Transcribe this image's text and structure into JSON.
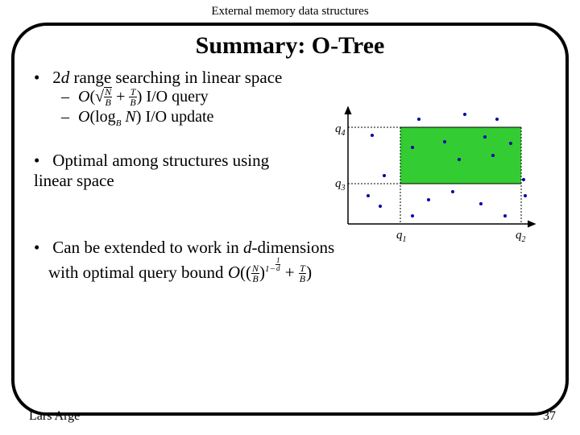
{
  "header": "External memory data structures",
  "title": "Summary: O-Tree",
  "bullets": {
    "b1_prefix": "2",
    "b1_var": "d",
    "b1_rest": " range searching in linear space",
    "s1_suffix": "I/O query",
    "s2_suffix": "I/O update",
    "b2": "Optimal among structures using linear space",
    "b3_line1": "Can be extended to work in ",
    "b3_var": "d",
    "b3_line1b": "-dimensions",
    "b3_line2": "with optimal query bound"
  },
  "math": {
    "O": "O",
    "lparen": "(",
    "rparen": ")",
    "sqrt": "√",
    "plus": " + ",
    "NB_num": "N",
    "NB_den": "B",
    "TB_num": "T",
    "TB_den": "B",
    "log": "log",
    "logsub": "B",
    "logarg": " N",
    "exp_prefix": "1−",
    "exp_frac_num": "1",
    "exp_frac_den": "d"
  },
  "figure": {
    "q1": "q",
    "q1sub": "1",
    "q2": "q",
    "q2sub": "2",
    "q3": "q",
    "q3sub": "3",
    "q4": "q",
    "q4sub": "4"
  },
  "footer": {
    "author": "Lars Arge",
    "page": "37"
  },
  "chart_data": {
    "type": "scatter",
    "title": "2D range query illustration",
    "x_range": [
      0,
      240
    ],
    "y_range": [
      0,
      150
    ],
    "query_rect": {
      "x1": 70,
      "x2": 225,
      "y_bottom": 0,
      "y_top": 105
    },
    "labels": {
      "x_left": "q1",
      "x_right": "q2",
      "y_bottom": "q3",
      "y_top": "q4"
    },
    "points_inside": [
      [
        88,
        90
      ],
      [
        185,
        92
      ],
      [
        118,
        60
      ],
      [
        160,
        70
      ],
      [
        178,
        55
      ],
      [
        200,
        88
      ]
    ],
    "points_outside": [
      [
        40,
        108
      ],
      [
        60,
        60
      ],
      [
        58,
        22
      ],
      [
        35,
        35
      ],
      [
        100,
        120
      ],
      [
        165,
        135
      ],
      [
        200,
        128
      ],
      [
        225,
        35
      ],
      [
        230,
        8
      ],
      [
        232,
        50
      ],
      [
        120,
        10
      ],
      [
        150,
        22
      ],
      [
        180,
        12
      ],
      [
        90,
        18
      ],
      [
        200,
        5
      ]
    ]
  }
}
